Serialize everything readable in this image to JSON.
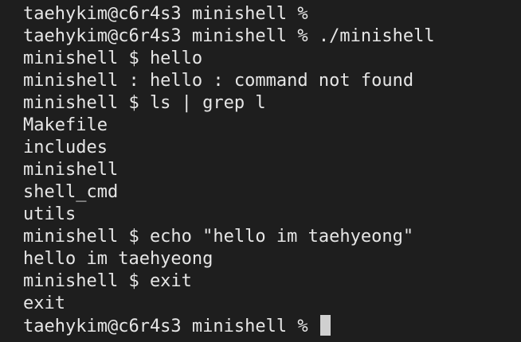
{
  "terminal": {
    "lines": [
      "taehykim@c6r4s3 minishell %",
      "taehykim@c6r4s3 minishell % ./minishell",
      "minishell $ hello",
      "minishell : hello : command not found",
      "minishell $ ls | grep l",
      "Makefile",
      "includes",
      "minishell",
      "shell_cmd",
      "utils",
      "minishell $ echo \"hello im taehyeong\"",
      "hello im taehyeong",
      "minishell $ exit",
      "exit"
    ],
    "current_prompt": "taehykim@c6r4s3 minishell % "
  }
}
